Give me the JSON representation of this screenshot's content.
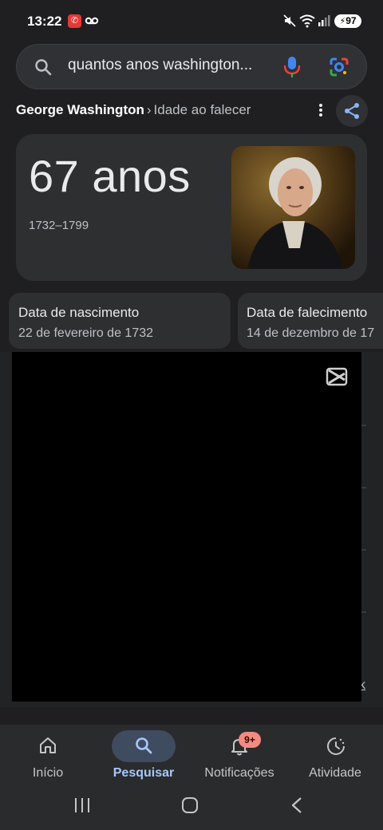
{
  "status_bar": {
    "time": "13:22",
    "battery": "97"
  },
  "search": {
    "query": "quantos anos washington..."
  },
  "breadcrumb": {
    "entity": "George Washington",
    "separator": "›",
    "attribute": "Idade ao falecer"
  },
  "answer": {
    "age": "67 anos",
    "years": "1732–1799"
  },
  "facts": [
    {
      "title": "Data de nascimento",
      "value": "22 de fevereiro de 1732"
    },
    {
      "title": "Data de falecimento",
      "value": "14 de dezembro de 17"
    }
  ],
  "background_link": "k",
  "bottom_nav": {
    "items": [
      {
        "label": "Início",
        "icon": "home-icon"
      },
      {
        "label": "Pesquisar",
        "icon": "search-icon"
      },
      {
        "label": "Notificações",
        "icon": "bell-icon"
      },
      {
        "label": "Atividade",
        "icon": "activity-icon"
      }
    ],
    "notifications_badge": "9+",
    "active": "Pesquisar"
  },
  "colors": {
    "background": "#1f1f21",
    "card": "#2e2f31",
    "accent": "#a8c7fa",
    "badge": "#f28b82"
  }
}
